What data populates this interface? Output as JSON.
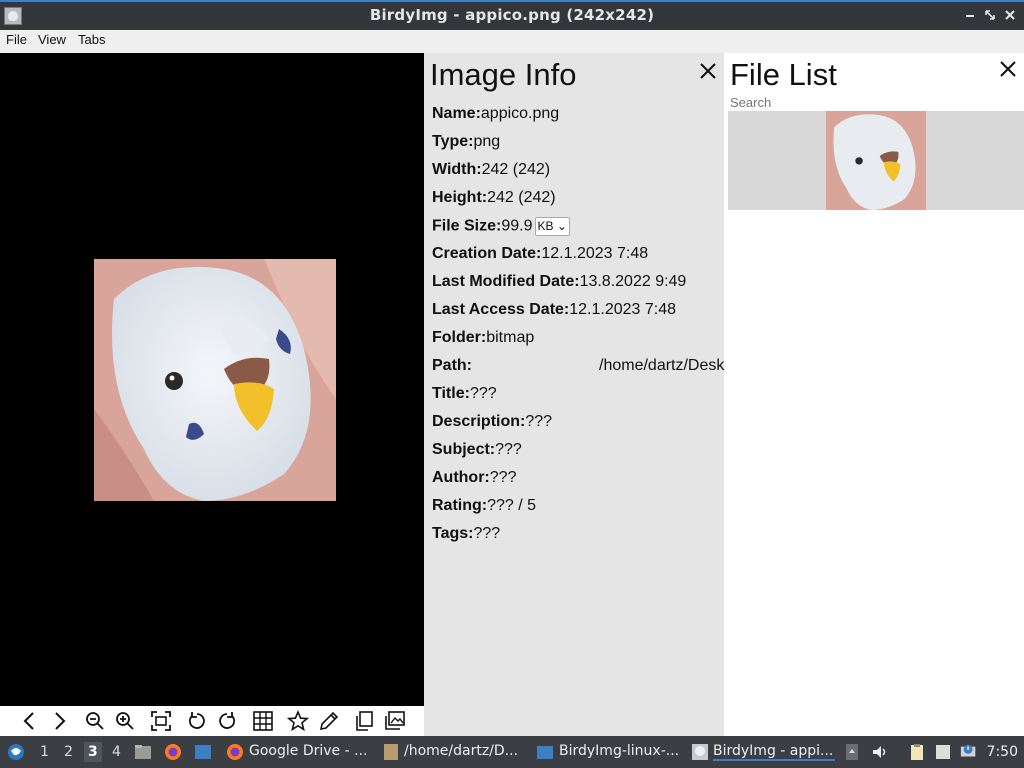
{
  "window": {
    "title": "BirdyImg - appico.png (242x242)",
    "controls": [
      "minimize",
      "maximize",
      "close"
    ]
  },
  "menubar": {
    "items": [
      "File",
      "View",
      "Tabs"
    ]
  },
  "toolbar": {
    "buttons": [
      "previous",
      "next",
      "zoom-out",
      "zoom-in",
      "fit",
      "rotate-left",
      "rotate-right",
      "grid",
      "favorite",
      "edit",
      "copy",
      "gallery"
    ]
  },
  "info": {
    "heading": "Image Info",
    "rows": {
      "name": {
        "label": "Name:",
        "value": "appico.png"
      },
      "type": {
        "label": "Type:",
        "value": "png"
      },
      "width": {
        "label": "Width:",
        "value": "242 (242)"
      },
      "height": {
        "label": "Height:",
        "value": "242 (242)"
      },
      "filesize": {
        "label": "File Size:",
        "value": "99.9",
        "unit": "KB"
      },
      "created": {
        "label": "Creation Date:",
        "value": "12.1.2023 7:48"
      },
      "modified": {
        "label": "Last Modified Date:",
        "value": "13.8.2022 9:49"
      },
      "accessed": {
        "label": "Last Access Date:",
        "value": "12.1.2023 7:48"
      },
      "folder": {
        "label": "Folder:",
        "value": "bitmap"
      },
      "path": {
        "label": "Path:",
        "value": "/home/dartz/Desk"
      },
      "title": {
        "label": "Title:",
        "value": "???"
      },
      "description": {
        "label": "Description:",
        "value": "???"
      },
      "subject": {
        "label": "Subject:",
        "value": "???"
      },
      "author": {
        "label": "Author:",
        "value": "???"
      },
      "rating": {
        "label": "Rating:",
        "value": "??? / 5"
      },
      "tags": {
        "label": "Tags:",
        "value": "???"
      }
    }
  },
  "filelist": {
    "heading": "File List",
    "search_placeholder": "Search"
  },
  "taskbar": {
    "workspaces": [
      "1",
      "2",
      "3",
      "4"
    ],
    "active_workspace": "3",
    "tasks": {
      "gdrive": "Google Drive - ...",
      "folder": "/home/dartz/D...",
      "birdy_folder": "BirdyImg-linux-...",
      "birdy_app": "BirdyImg - appi..."
    },
    "clock": "7:50"
  },
  "colors": {
    "titlebar": "#33363b",
    "accent": "#3d7fc5",
    "viewer_bg": "#000000",
    "info_bg": "#e5e5e5",
    "taskbar": "#3b3f44"
  }
}
